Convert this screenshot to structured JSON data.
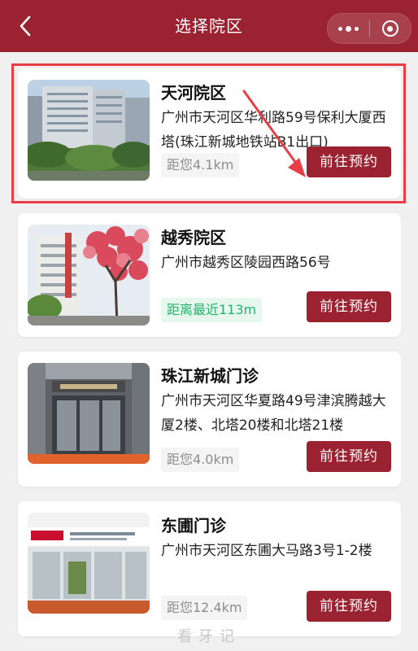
{
  "header": {
    "title": "选择院区",
    "back_icon": "chevron-left-icon",
    "more_icon": "more-dots-icon",
    "close_icon": "target-circle-icon",
    "background": "#9b2230"
  },
  "campuses": [
    {
      "name": "天河院区",
      "address": "广州市天河区华利路59号保利大厦西塔(珠江新城地铁站B1出口)",
      "distance": "距您4.1km",
      "distance_style": "gray",
      "button": "前往预约"
    },
    {
      "name": "越秀院区",
      "address": "广州市越秀区陵园西路56号",
      "distance": "距离最近113m",
      "distance_style": "green",
      "button": "前往预约"
    },
    {
      "name": "珠江新城门诊",
      "address": "广州市天河区华夏路49号津滨腾越大厦2楼、北塔20楼和北塔21楼",
      "distance": "距您4.0km",
      "distance_style": "gray",
      "button": "前往预约"
    },
    {
      "name": "东圃门诊",
      "address": "广州市天河区东圃大马路3号1-2楼",
      "distance": "距您12.4km",
      "distance_style": "gray",
      "button": "前往预约"
    }
  ],
  "watermark": "看牙记",
  "colors": {
    "accent": "#9b2230",
    "highlight": "#e83e45",
    "near": "#24b36b"
  }
}
